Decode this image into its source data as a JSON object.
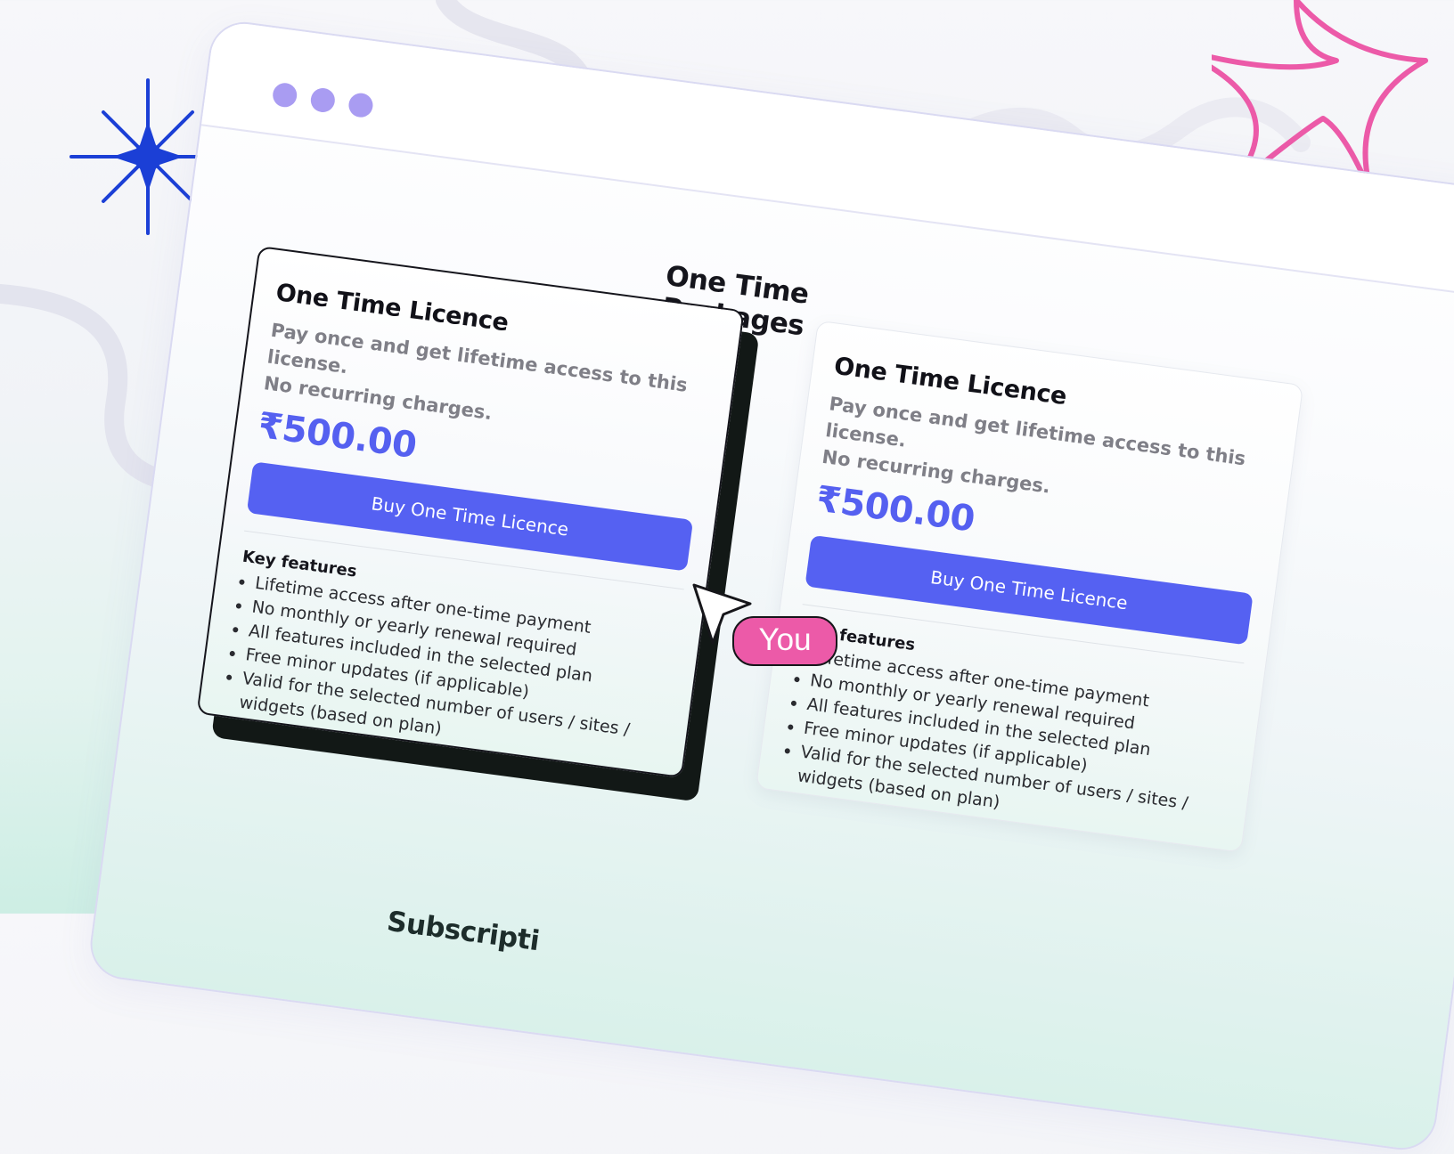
{
  "section": {
    "title": "One Time Packages",
    "next_title": "Subscripti"
  },
  "cards": [
    {
      "title": "One Time Licence",
      "desc_line1": "Pay once and get lifetime access to this license.",
      "desc_line2": "No recurring charges.",
      "price": "₹500.00",
      "button": "Buy One Time Licence",
      "features_title": "Key features",
      "features": [
        "Lifetime access after one-time payment",
        "No monthly or yearly renewal required",
        "All features included in the selected plan",
        "Free minor updates (if applicable)",
        "Valid for the selected number of users / sites / widgets (based on plan)"
      ]
    },
    {
      "title": "One Time Licence",
      "desc_line1": "Pay once and get lifetime access to this license.",
      "desc_line2": "No recurring charges.",
      "price": "₹500.00",
      "button": "Buy One Time Licence",
      "features_title": "Key features",
      "features": [
        "Lifetime access after one-time payment",
        "No monthly or yearly renewal required",
        "All features included in the selected plan",
        "Free minor updates (if applicable)",
        "Valid for the selected number of users / sites / widgets (based on plan)"
      ]
    }
  ],
  "cursor": {
    "label": "You",
    "icon": "cursor-arrow-icon"
  },
  "decor": {
    "spark_left_icon": "sparkle-icon",
    "spark_left_color": "#1b3fd6",
    "spark_right_icon": "star-outline-icon",
    "spark_right_color": "#ec5aa8",
    "accent": "#5561f2",
    "window_dot_color": "#a99cf2"
  }
}
